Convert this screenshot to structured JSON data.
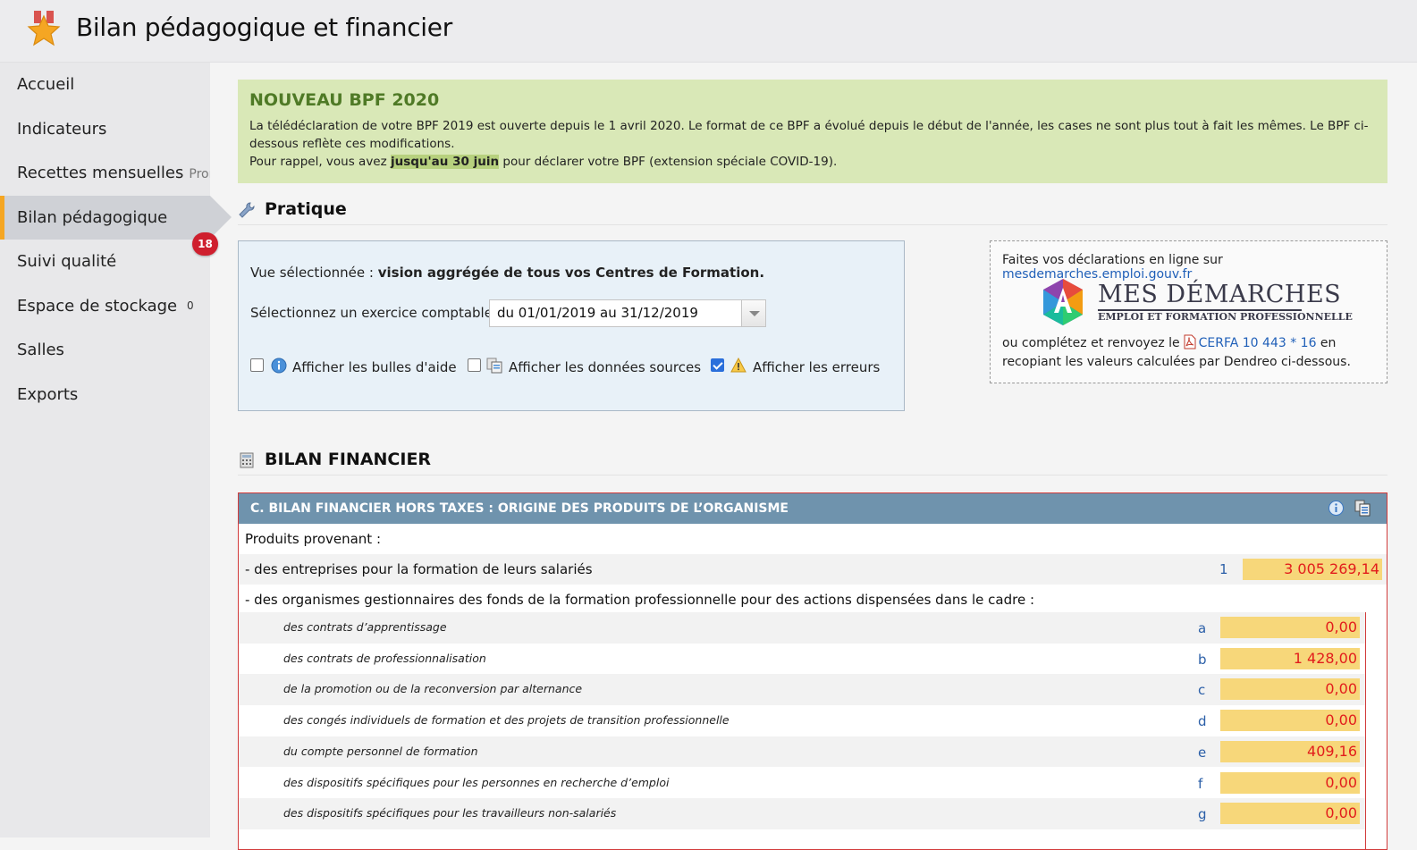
{
  "header": {
    "title": "Bilan pédagogique et financier",
    "logo_icon": "award-star-icon"
  },
  "sidebar": {
    "items": [
      {
        "label": "Accueil"
      },
      {
        "label": "Indicateurs"
      },
      {
        "label": "Recettes mensuelles",
        "extra": "Prorata"
      },
      {
        "label": "Bilan pédagogique",
        "active": true
      },
      {
        "label": "Suivi qualité"
      },
      {
        "label": "Espace de stockage"
      },
      {
        "label": "Salles"
      },
      {
        "label": "Exports"
      }
    ],
    "badge": "18",
    "storage_count": "0"
  },
  "notice": {
    "title": "NOUVEAU BPF 2020",
    "line1": "La télédéclaration de votre BPF 2019 est ouverte depuis le 1 avril 2020. Le format de ce BPF a évolué depuis le début de l'année, les cases ne sont plus tout à fait les mêmes. Le BPF ci-dessous reflète ces modifications.",
    "line2_pre": "Pour rappel, vous avez ",
    "line2_hl": "jusqu'au 30 juin",
    "line2_post": " pour déclarer votre BPF (extension spéciale COVID-19)."
  },
  "pratique": {
    "title": "Pratique",
    "vue_label": "Vue sélectionnée : ",
    "vue_value": "vision aggrégée de tous vos Centres de Formation.",
    "exercice_label": "Sélectionnez un exercice comptable :",
    "exercice_value": "du 01/01/2019 au 31/12/2019",
    "checkboxes": [
      {
        "label": "Afficher les bulles d'aide",
        "checked": false,
        "icon": "info-icon"
      },
      {
        "label": "Afficher les données sources",
        "checked": false,
        "icon": "data-sources-icon"
      },
      {
        "label": "Afficher les erreurs",
        "checked": true,
        "icon": "warning-icon"
      }
    ]
  },
  "online": {
    "text_pre": "Faites vos déclarations en ligne sur ",
    "link": "mesdemarches.emploi.gouv.fr",
    "logo_title": "MES DÉMARCHES",
    "logo_sub": "EMPLOI ET FORMATION PROFESSIONNELLE",
    "text2_pre": "ou complétez et renvoyez le",
    "cerfa_link": "CERFA 10 443 * 16",
    "text2_post": " en recopiant les valeurs calculées par Dendreo ci-dessous."
  },
  "bilan": {
    "title": "BILAN FINANCIER",
    "panel_title": "C. BILAN FINANCIER HORS TAXES : ORIGINE DES PRODUITS DE L’ORGANISME",
    "rows": [
      {
        "label": "Produits provenant :"
      },
      {
        "label": "- des entreprises pour la formation de leurs salariés",
        "code": "1",
        "value": "3 005 269,14"
      },
      {
        "label": "- des organismes gestionnaires des fonds de la formation professionnelle pour des actions dispensées dans le cadre :"
      }
    ],
    "sub_rows": [
      {
        "label": "des contrats d’apprentissage",
        "code": "a",
        "value": "0,00"
      },
      {
        "label": "des contrats de professionnalisation",
        "code": "b",
        "value": "1 428,00"
      },
      {
        "label": "de la promotion ou de la reconversion par alternance",
        "code": "c",
        "value": "0,00"
      },
      {
        "label": "des congés individuels de formation et des projets de transition professionnelle",
        "code": "d",
        "value": "0,00"
      },
      {
        "label": "du compte personnel de formation",
        "code": "e",
        "value": "409,16"
      },
      {
        "label": "des dispositifs spécifiques pour les personnes en recherche d’emploi",
        "code": "f",
        "value": "0,00"
      },
      {
        "label": "des dispositifs spécifiques pour les travailleurs non-salariés",
        "code": "g",
        "value": "0,00"
      }
    ]
  }
}
